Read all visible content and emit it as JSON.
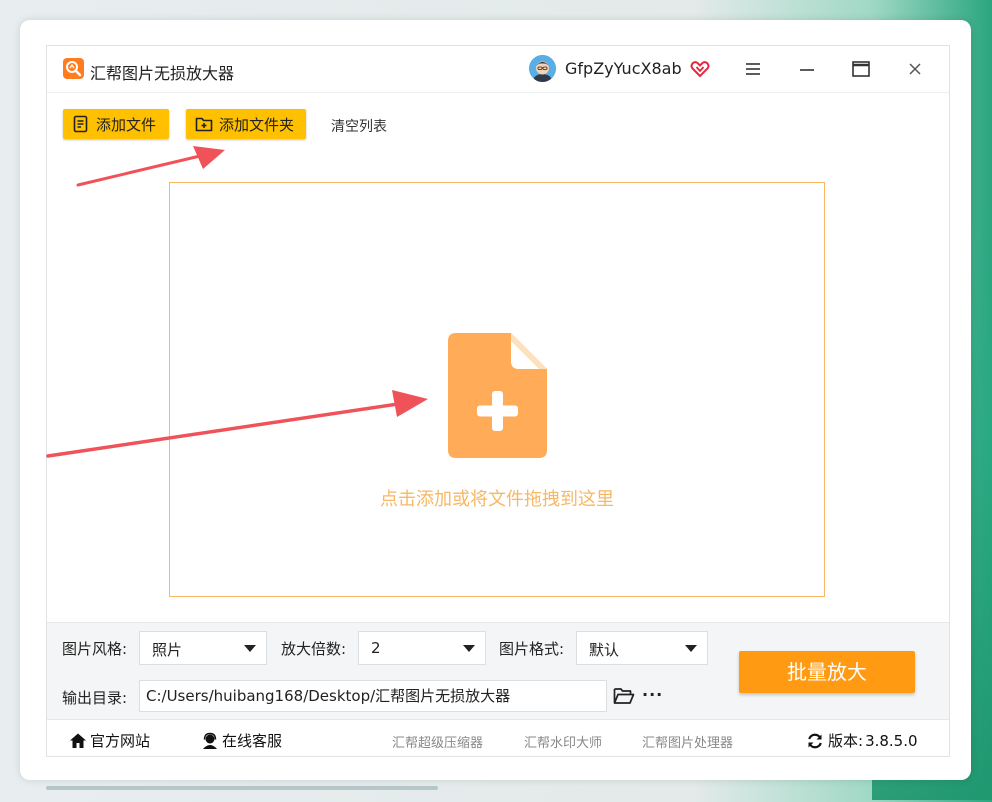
{
  "app": {
    "title": "汇帮图片无损放大器",
    "username": "GfpZyYucX8ab"
  },
  "toolbar": {
    "add_file_label": "添加文件",
    "add_folder_label": "添加文件夹",
    "clear_list_label": "清空列表"
  },
  "dropzone": {
    "hint": "点击添加或将文件拖拽到这里"
  },
  "settings": {
    "style_label": "图片风格:",
    "style_value": "照片",
    "scale_label": "放大倍数:",
    "scale_value": "2",
    "format_label": "图片格式:",
    "format_value": "默认",
    "output_label": "输出目录:",
    "output_path": "C:/Users/huibang168/Desktop/汇帮图片无损放大器",
    "more_label": "···",
    "batch_button": "批量放大"
  },
  "footer": {
    "website": "官方网站",
    "support": "在线客服",
    "link1": "汇帮超级压缩器",
    "link2": "汇帮水印大师",
    "link3": "汇帮图片处理器",
    "version_label": "版本:",
    "version": "3.8.5.0"
  },
  "colors": {
    "accent_yellow": "#ffc000",
    "accent_orange": "#ff9a12",
    "dropzone_border": "#f9b867",
    "file_icon": "#ffab57",
    "annotation_arrow": "#f0525a"
  },
  "icons": {
    "app_logo": "app-logo-icon",
    "vip": "vip-heart-icon",
    "menu": "menu-icon",
    "minimize": "minimize-icon",
    "maximize": "maximize-icon",
    "close": "close-icon",
    "add_file": "add-file-icon",
    "add_folder": "add-folder-icon",
    "drop_file": "file-plus-icon",
    "folder": "folder-open-icon",
    "home": "home-icon",
    "support": "support-agent-icon",
    "refresh": "refresh-icon"
  }
}
